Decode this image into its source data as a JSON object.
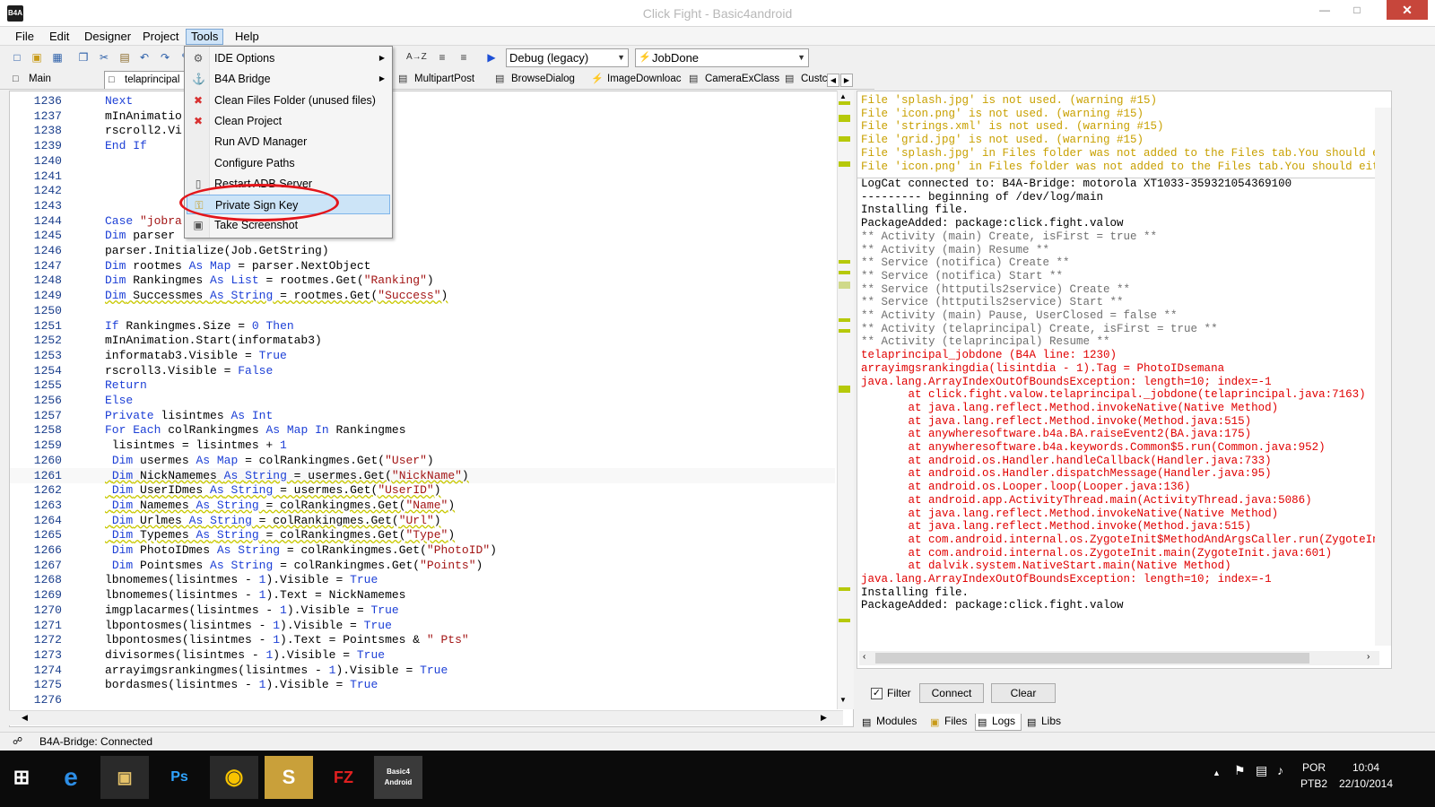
{
  "window": {
    "title": "Click Fight - Basic4android",
    "icon_text": "B4A"
  },
  "menu": [
    "File",
    "Edit",
    "Designer",
    "Project",
    "Tools",
    "Help"
  ],
  "toolbar": {
    "config": "Debug (legacy)",
    "module": "JobDone",
    "az": "A→Z"
  },
  "tabs": [
    "Main",
    "telaprincipal",
    "MultipartPost",
    "BrowseDialog",
    "ImageDownloac",
    "CameraExClass",
    "Custc"
  ],
  "tools_menu": [
    {
      "label": "IDE Options",
      "icon": "gear-icon",
      "submenu": true
    },
    {
      "label": "B4A Bridge",
      "icon": "bridge-icon",
      "submenu": true
    },
    {
      "label": "Clean Files Folder (unused files)",
      "icon": "x-icon"
    },
    {
      "label": "Clean Project",
      "icon": "x-icon"
    },
    {
      "label": "Run AVD Manager",
      "icon": ""
    },
    {
      "label": "Configure Paths",
      "icon": ""
    },
    {
      "label": "Restart ADB Server",
      "icon": "phone-icon"
    },
    {
      "label": "Private Sign Key",
      "icon": "key-icon"
    },
    {
      "label": "Take Screenshot",
      "icon": "screenshot-icon"
    }
  ],
  "code_lines": [
    {
      "n": "1236",
      "t": "Next"
    },
    {
      "n": "1237",
      "t": "mInAnimatio"
    },
    {
      "n": "1238",
      "t": "rscroll2.Vi"
    },
    {
      "n": "1239",
      "t": "End If"
    },
    {
      "n": "1240",
      "t": ""
    },
    {
      "n": "1241",
      "t": ""
    },
    {
      "n": "1242",
      "t": ""
    },
    {
      "n": "1243",
      "t": ""
    },
    {
      "n": "1244",
      "t": "Case \"jobra"
    },
    {
      "n": "1245",
      "t": "Dim parser "
    },
    {
      "n": "1246",
      "t": "parser.Initialize(Job.GetString)"
    },
    {
      "n": "1247",
      "t": "Dim rootmes As Map = parser.NextObject"
    },
    {
      "n": "1248",
      "t": "Dim Rankingmes As List = rootmes.Get(\"Ranking\")"
    },
    {
      "n": "1249",
      "t": "Dim Successmes As String = rootmes.Get(\"Success\")"
    },
    {
      "n": "1250",
      "t": ""
    },
    {
      "n": "1251",
      "t": "If Rankingmes.Size = 0 Then"
    },
    {
      "n": "1252",
      "t": "mInAnimation.Start(informatab3)"
    },
    {
      "n": "1253",
      "t": "informatab3.Visible = True"
    },
    {
      "n": "1254",
      "t": "rscroll3.Visible = False"
    },
    {
      "n": "1255",
      "t": "Return"
    },
    {
      "n": "1256",
      "t": "Else"
    },
    {
      "n": "1257",
      "t": "Private lisintmes As Int"
    },
    {
      "n": "1258",
      "t": "For Each colRankingmes As Map In Rankingmes"
    },
    {
      "n": "1259",
      "t": " lisintmes = lisintmes + 1"
    },
    {
      "n": "1260",
      "t": " Dim usermes As Map = colRankingmes.Get(\"User\")"
    },
    {
      "n": "1261",
      "t": " Dim NickNamemes As String = usermes.Get(\"NickName\")"
    },
    {
      "n": "1262",
      "t": " Dim UserIDmes As String = usermes.Get(\"UserID\")"
    },
    {
      "n": "1263",
      "t": " Dim Namemes As String = colRankingmes.Get(\"Name\")"
    },
    {
      "n": "1264",
      "t": " Dim Urlmes As String = colRankingmes.Get(\"Url\")"
    },
    {
      "n": "1265",
      "t": " Dim Typemes As String = colRankingmes.Get(\"Type\")"
    },
    {
      "n": "1266",
      "t": " Dim PhotoIDmes As String = colRankingmes.Get(\"PhotoID\")"
    },
    {
      "n": "1267",
      "t": " Dim Pointsmes As String = colRankingmes.Get(\"Points\")"
    },
    {
      "n": "1268",
      "t": "lbnomemes(lisintmes - 1).Visible = True"
    },
    {
      "n": "1269",
      "t": "lbnomemes(lisintmes - 1).Text = NickNamemes"
    },
    {
      "n": "1270",
      "t": "imgplacarmes(lisintmes - 1).Visible = True"
    },
    {
      "n": "1271",
      "t": "lbpontosmes(lisintmes - 1).Visible = True"
    },
    {
      "n": "1272",
      "t": "lbpontosmes(lisintmes - 1).Text = Pointsmes & \" Pts\""
    },
    {
      "n": "1273",
      "t": "divisormes(lisintmes - 1).Visible = True"
    },
    {
      "n": "1274",
      "t": "arrayimgsrankingmes(lisintmes - 1).Visible = True"
    },
    {
      "n": "1275",
      "t": "bordasmes(lisintmes - 1).Visible = True"
    },
    {
      "n": "1276",
      "t": ""
    }
  ],
  "warnings": [
    "File 'splash.jpg' is not used. (warning #15)",
    "File 'icon.png' is not used. (warning #15)",
    "File 'strings.xml' is not used. (warning #15)",
    "File 'grid.jpg' is not used. (warning #15)",
    "File 'splash.jpg' in Files folder was not added to the Files tab.You should either d",
    "File 'icon.png' in Files folder was not added to the Files tab.You should either del"
  ],
  "log_lines": [
    {
      "c": "b",
      "t": "LogCat connected to: B4A-Bridge: motorola XT1033-359321054369100"
    },
    {
      "c": "b",
      "t": "--------- beginning of /dev/log/main"
    },
    {
      "c": "b",
      "t": "Installing file."
    },
    {
      "c": "b",
      "t": "PackageAdded: package:click.fight.valow"
    },
    {
      "c": "g",
      "t": "** Activity (main) Create, isFirst = true **"
    },
    {
      "c": "g",
      "t": "** Activity (main) Resume **"
    },
    {
      "c": "g",
      "t": "** Service (notifica) Create **"
    },
    {
      "c": "g",
      "t": "** Service (notifica) Start **"
    },
    {
      "c": "g",
      "t": "** Service (httputils2service) Create **"
    },
    {
      "c": "g",
      "t": "** Service (httputils2service) Start **"
    },
    {
      "c": "g",
      "t": "** Activity (main) Pause, UserClosed = false **"
    },
    {
      "c": "g",
      "t": "** Activity (telaprincipal) Create, isFirst = true **"
    },
    {
      "c": "g",
      "t": "** Activity (telaprincipal) Resume **"
    },
    {
      "c": "r",
      "t": "telaprincipal_jobdone (B4A line: 1230)"
    },
    {
      "c": "r",
      "t": "arrayimgsrankingdia(lisintdia - 1).Tag = PhotoIDsemana"
    },
    {
      "c": "r",
      "t": "java.lang.ArrayIndexOutOfBoundsException: length=10; index=-1"
    },
    {
      "c": "r",
      "t": "       at click.fight.valow.telaprincipal._jobdone(telaprincipal.java:7163)"
    },
    {
      "c": "r",
      "t": "       at java.lang.reflect.Method.invokeNative(Native Method)"
    },
    {
      "c": "r",
      "t": "       at java.lang.reflect.Method.invoke(Method.java:515)"
    },
    {
      "c": "r",
      "t": "       at anywheresoftware.b4a.BA.raiseEvent2(BA.java:175)"
    },
    {
      "c": "r",
      "t": "       at anywheresoftware.b4a.keywords.Common$5.run(Common.java:952)"
    },
    {
      "c": "r",
      "t": "       at android.os.Handler.handleCallback(Handler.java:733)"
    },
    {
      "c": "r",
      "t": "       at android.os.Handler.dispatchMessage(Handler.java:95)"
    },
    {
      "c": "r",
      "t": "       at android.os.Looper.loop(Looper.java:136)"
    },
    {
      "c": "r",
      "t": "       at android.app.ActivityThread.main(ActivityThread.java:5086)"
    },
    {
      "c": "r",
      "t": "       at java.lang.reflect.Method.invokeNative(Native Method)"
    },
    {
      "c": "r",
      "t": "       at java.lang.reflect.Method.invoke(Method.java:515)"
    },
    {
      "c": "r",
      "t": "       at com.android.internal.os.ZygoteInit$MethodAndArgsCaller.run(ZygoteInit."
    },
    {
      "c": "r",
      "t": "       at com.android.internal.os.ZygoteInit.main(ZygoteInit.java:601)"
    },
    {
      "c": "r",
      "t": "       at dalvik.system.NativeStart.main(Native Method)"
    },
    {
      "c": "r",
      "t": "java.lang.ArrayIndexOutOfBoundsException: length=10; index=-1"
    },
    {
      "c": "b",
      "t": "Installing file."
    },
    {
      "c": "b",
      "t": "PackageAdded: package:click.fight.valow"
    }
  ],
  "log_controls": {
    "filter_label": "Filter",
    "connect": "Connect",
    "clear": "Clear"
  },
  "panel_tabs": [
    "Modules",
    "Files",
    "Logs",
    "Libs"
  ],
  "status": "B4A-Bridge: Connected",
  "taskbar": {
    "lang": "POR",
    "layout": "PTB2",
    "time": "10:04",
    "date": "22/10/2014",
    "ps": "Ps",
    "skype": "S",
    "filezilla": "FZ",
    "b4a": "Basic4 Android"
  },
  "colors": {
    "accent_red": "#e3161b",
    "keyword": "#1c3fd6",
    "string": "#a31515",
    "error": "#e00000",
    "warning": "#c8a000"
  }
}
